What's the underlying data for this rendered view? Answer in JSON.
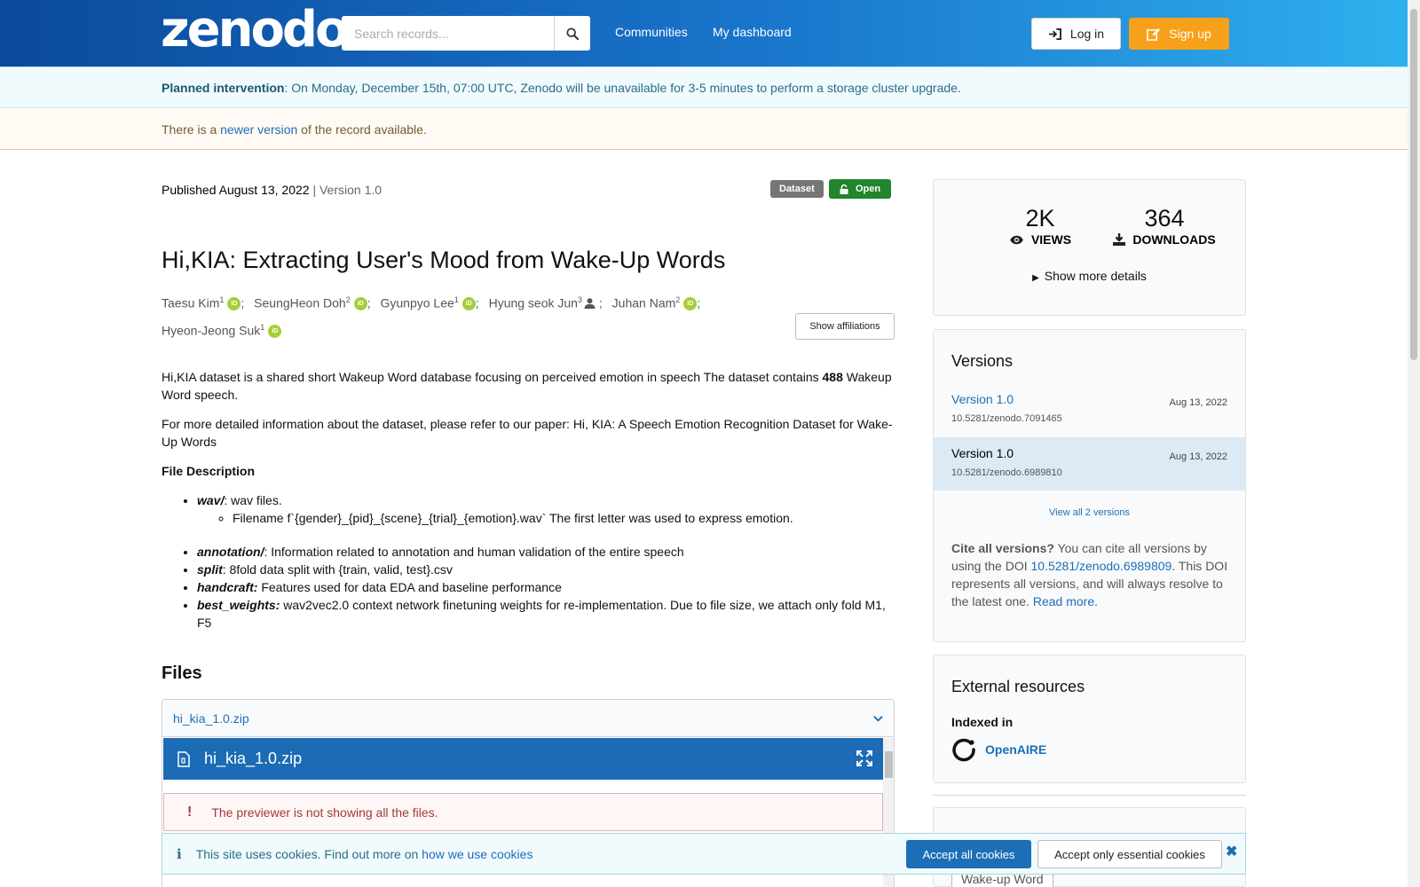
{
  "header": {
    "logo": "zenodo",
    "search_placeholder": "Search records...",
    "nav": [
      "Communities",
      "My dashboard"
    ],
    "login_label": "Log in",
    "signup_label": "Sign up"
  },
  "banners": {
    "intervention_bold": "Planned intervention",
    "intervention_text": ": On Monday, December 15th, 07:00 UTC, Zenodo will be unavailable for 3-5 minutes to perform a storage cluster upgrade.",
    "newer_pre": "There is a ",
    "newer_link": "newer version",
    "newer_post": " of the record available."
  },
  "record": {
    "published": "Published August 13, 2022",
    "version_sep": " | Version 1.0",
    "type_badge": "Dataset",
    "access_badge": "Open",
    "title": "Hi,KIA: Extracting User's Mood from Wake-Up Words",
    "authors": [
      {
        "name": "Taesu Kim",
        "aff": "1",
        "id": "orcid"
      },
      {
        "name": "SeungHeon Doh",
        "aff": "2",
        "id": "orcid"
      },
      {
        "name": "Gyunpyo Lee",
        "aff": "1",
        "id": "orcid"
      },
      {
        "name": "Hyung seok Jun",
        "aff": "3",
        "id": "person"
      },
      {
        "name": "Juhan Nam",
        "aff": "2",
        "id": "orcid"
      },
      {
        "name": "Hyeon-Jeong Suk",
        "aff": "1",
        "id": "orcid"
      }
    ],
    "show_affiliations": "Show affiliations",
    "desc_p1_a": "Hi,KIA dataset is a shared short Wakeup Word database focusing on perceived emotion in speech The dataset contains ",
    "desc_p1_b": "488",
    "desc_p1_c": " Wakeup Word speech.",
    "desc_p2": "For more detailed information about the dataset, please refer to our paper: Hi, KIA: A Speech Emotion Recognition Dataset for Wake-Up Words",
    "file_desc_heading": "File Description",
    "items": [
      {
        "key": "wav/",
        "text": ": wav files."
      },
      {
        "key": "annotation/",
        "text": ": Information related to annotation and human validation of the entire speech"
      },
      {
        "key": "split",
        "text": ": 8fold data split with {train, valid, test}.csv"
      },
      {
        "key": "handcraft:",
        "text": " Features used for data EDA and baseline performance"
      },
      {
        "key": "best_weights:",
        "text": " wav2vec2.0 context network finetuning weights for re-implementation. Due to file size, we attach only fold M1, F5"
      }
    ],
    "wav_sub": "Filename f`{gender}_{pid}_{scene}_{trial}_{emotion}.wav` The first letter was used to express emotion."
  },
  "files": {
    "heading": "Files",
    "accordion_file": "hi_kia_1.0.zip",
    "preview_file": "hi_kia_1.0.zip",
    "warning": "The previewer is not showing all the files."
  },
  "stats": {
    "views_num": "2K",
    "views_label": "VIEWS",
    "downloads_num": "364",
    "downloads_label": "DOWNLOADS",
    "more_details": "Show more details"
  },
  "versions": {
    "heading": "Versions",
    "list": [
      {
        "name": "Version 1.0",
        "date": "Aug 13, 2022",
        "doi": "10.5281/zenodo.7091465",
        "active": false
      },
      {
        "name": "Version 1.0",
        "date": "Aug 13, 2022",
        "doi": "10.5281/zenodo.6989810",
        "active": true
      }
    ],
    "view_all": "View all 2 versions",
    "cite_bold": "Cite all versions?",
    "cite_pre": " You can cite all versions by using the DOI ",
    "cite_doi": "10.5281/zenodo.6989809",
    "cite_post": ". This DOI represents all versions, and will always resolve to the latest one. ",
    "read_more": "Read more."
  },
  "external": {
    "heading": "External resources",
    "indexed_in": "Indexed in",
    "openaire": "OpenAIRE"
  },
  "keyword": "Wake-up Word",
  "cookie": {
    "text": "This site uses cookies. Find out more on ",
    "link": "how we use cookies",
    "accept_all": "Accept all cookies",
    "accept_essential": "Accept only essential cookies"
  },
  "colors": {
    "primary": "#1c6eb7",
    "signup": "#f7a11a",
    "open_badge": "#20852c",
    "header_start": "#0b4a9c",
    "header_end": "#2fb0ee"
  }
}
